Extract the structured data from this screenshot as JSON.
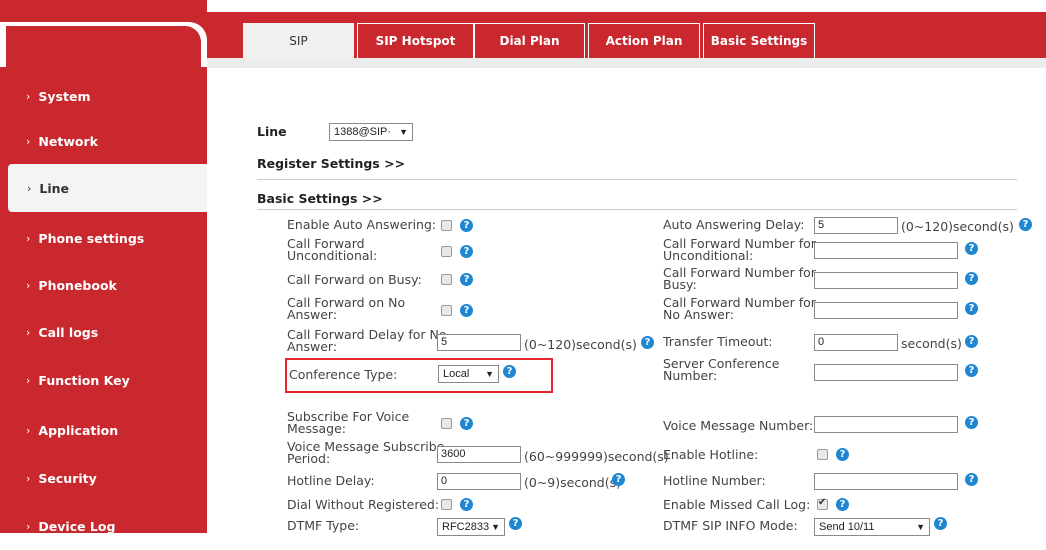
{
  "sidebar": {
    "items": [
      {
        "label": "System",
        "chevron": "›"
      },
      {
        "label": "Network",
        "chevron": "›"
      },
      {
        "label": "Line",
        "chevron": "›"
      },
      {
        "label": "Phone settings",
        "chevron": "›"
      },
      {
        "label": "Phonebook",
        "chevron": "›"
      },
      {
        "label": "Call logs",
        "chevron": "›"
      },
      {
        "label": "Function Key",
        "chevron": "›"
      },
      {
        "label": "Application",
        "chevron": "›"
      },
      {
        "label": "Security",
        "chevron": "›"
      },
      {
        "label": "Device Log",
        "chevron": "›"
      }
    ]
  },
  "tabs": [
    {
      "label": "SIP"
    },
    {
      "label": "SIP Hotspot"
    },
    {
      "label": "Dial Plan"
    },
    {
      "label": "Action Plan"
    },
    {
      "label": "Basic Settings"
    }
  ],
  "line": {
    "label": "Line",
    "value": "1388@SIP·"
  },
  "sections": {
    "register": "Register Settings >>",
    "basic": "Basic Settings >>"
  },
  "help_glyph": "?",
  "arrow_glyph": "▼",
  "left": {
    "auto_answer": "Enable Auto Answering:",
    "fwd_uncond": "Call Forward\nUnconditional:",
    "fwd_busy": "Call Forward on Busy:",
    "fwd_noans": "Call Forward on No\nAnswer:",
    "fwd_delay": "Call Forward Delay for No\nAnswer:",
    "fwd_delay_value": "5",
    "fwd_delay_unit": "(0~120)second(s)",
    "conf_type": "Conference Type:",
    "conf_type_value": "Local",
    "subscribe_vm": "Subscribe For Voice\nMessage:",
    "vm_period": "Voice Message Subscribe\nPeriod:",
    "vm_period_value": "3600",
    "vm_period_unit": "(60~999999)second(s)",
    "hotline_delay": "Hotline Delay:",
    "hotline_delay_value": "0",
    "hotline_delay_unit": "(0~9)second(s)",
    "dial_wo_reg": "Dial Without Registered:",
    "dtmf_type": "DTMF Type:",
    "dtmf_type_value": "RFC2833"
  },
  "right": {
    "auto_answer_delay": "Auto Answering Delay:",
    "auto_answer_delay_value": "5",
    "auto_answer_delay_unit": "(0~120)second(s)",
    "fwd_num_uncond": "Call Forward Number for\nUnconditional:",
    "fwd_num_busy": "Call Forward Number for\nBusy:",
    "fwd_num_noans": "Call Forward Number for\nNo Answer:",
    "transfer_timeout": "Transfer Timeout:",
    "transfer_timeout_value": "0",
    "transfer_timeout_unit": "second(s)",
    "server_conf": "Server Conference\nNumber:",
    "vm_number": "Voice Message Number:",
    "enable_hotline": "Enable Hotline:",
    "hotline_number": "Hotline Number:",
    "missed_log": "Enable Missed Call Log:",
    "dtmf_sip_info": "DTMF SIP INFO Mode:",
    "dtmf_sip_info_value": "Send 10/11"
  },
  "colors": {
    "brand": "#c8282e",
    "help": "#1f87d1",
    "highlight": "#e8272d"
  }
}
